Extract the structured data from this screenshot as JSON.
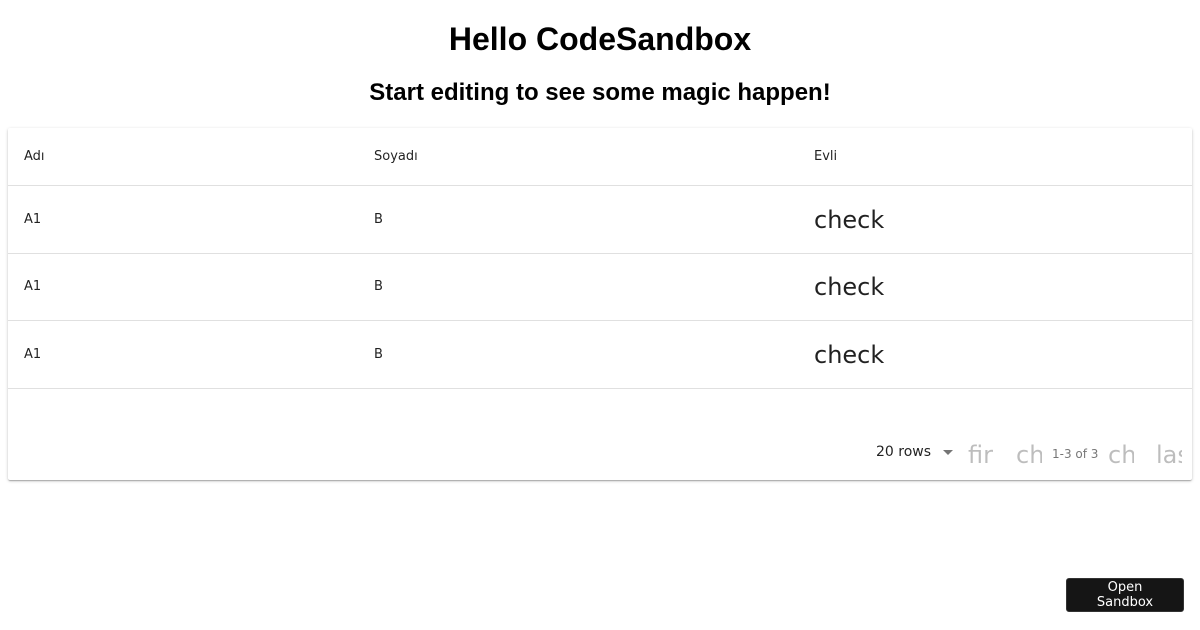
{
  "header": {
    "title": "Hello CodeSandbox",
    "subtitle": "Start editing to see some magic happen!"
  },
  "table": {
    "columns": [
      "Adı",
      "Soyadı",
      "Evli"
    ],
    "rows": [
      {
        "adi": "A1",
        "soyadi": "B",
        "evli_icon": "check"
      },
      {
        "adi": "A1",
        "soyadi": "B",
        "evli_icon": "check"
      },
      {
        "adi": "A1",
        "soyadi": "B",
        "evli_icon": "check"
      }
    ]
  },
  "pagination": {
    "rows_per_page": "20 rows",
    "first_icon": "first_page",
    "prev_icon": "chevron_left",
    "info": "1-3 of 3",
    "next_icon": "chevron_right",
    "last_icon": "last_page"
  },
  "sandbox_button": {
    "label": "Open Sandbox"
  }
}
